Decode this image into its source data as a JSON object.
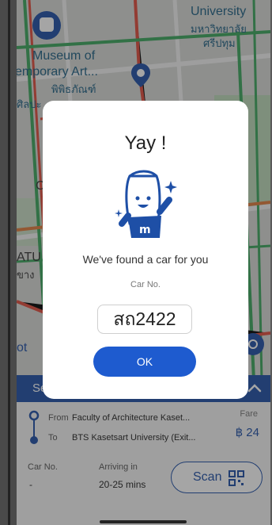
{
  "map": {
    "labels": {
      "university_en": "University",
      "university_th1": "มหาวิทยาลัย",
      "university_th2": "ศรีปทุม",
      "museum_line1": "Museum of",
      "museum_line2": "emporary Art...",
      "museum_th": "พิพิธภัณฑ์",
      "art_th": "ศิลปะ",
      "letter_c": "C",
      "atu": "ATU",
      "thai_side": "ขาง",
      "left_cut": "ot"
    }
  },
  "modal": {
    "title": "Yay !",
    "message": "We've found a car for you",
    "car_no_label": "Car No.",
    "plate": "สถ2422",
    "ok_label": "OK"
  },
  "sheet": {
    "header_title": "Se",
    "from_label": "From",
    "from_value": "Faculty of Architecture Kaset...",
    "to_label": "To",
    "to_value": "BTS Kasetsart University (Exit...",
    "fare_label": "Fare",
    "fare_value": "฿ 24",
    "car_no_label": "Car No.",
    "car_no_value": "-",
    "arriving_label": "Arriving in",
    "arriving_value": "20-25 mins",
    "scan_label": "Scan"
  },
  "colors": {
    "brand_blue": "#1e4fa6",
    "ok_blue": "#1e5bcf"
  }
}
